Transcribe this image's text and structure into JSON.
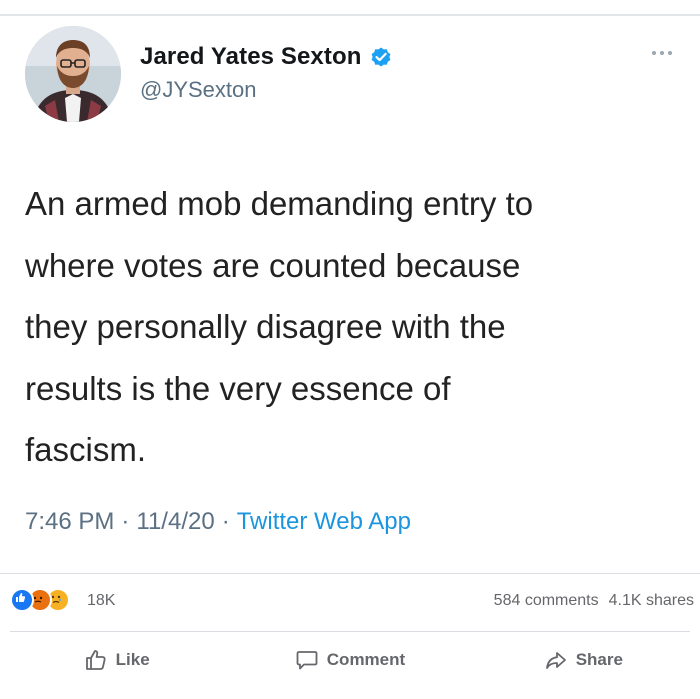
{
  "tweet": {
    "author": {
      "display_name": "Jared Yates Sexton",
      "handle": "@JYSexton",
      "verified": true,
      "avatar_icon": "avatar-photo"
    },
    "text": "An armed mob demanding entry to\nwhere votes are counted because\nthey personally disagree with the\nresults is the very essence of\nfascism.",
    "time": "7:46 PM",
    "date": "11/4/20",
    "source": "Twitter Web App",
    "separator": "·",
    "more_icon": "more-dots-icon"
  },
  "facebook": {
    "reactions": {
      "icons": [
        "like-reaction-icon",
        "angry-reaction-icon",
        "sad-reaction-icon"
      ],
      "count": "18K"
    },
    "comments": "584 comments",
    "shares": "4.1K shares",
    "actions": {
      "like": "Like",
      "comment": "Comment",
      "share": "Share"
    }
  },
  "colors": {
    "twitter_blue": "#1b95e0",
    "verified_blue": "#1da1f2",
    "secondary_text": "#5b7083",
    "fb_gray": "#65676b",
    "fb_like_blue": "#1877f2"
  }
}
